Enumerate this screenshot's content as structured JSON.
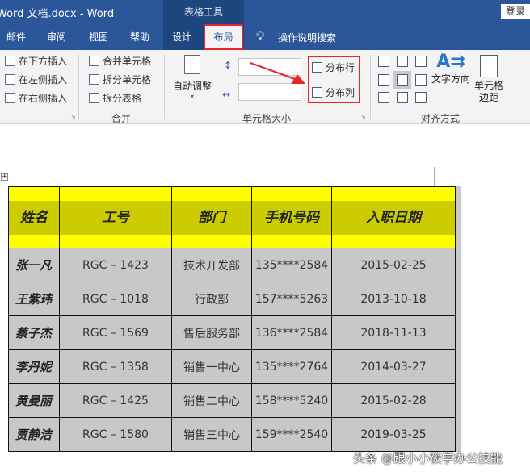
{
  "window": {
    "title": "Word 文档.docx  -  Word",
    "context_tab_group": "表格工具",
    "login_label": "登录"
  },
  "tabs": [
    {
      "label": "邮件"
    },
    {
      "label": "审阅"
    },
    {
      "label": "视图"
    },
    {
      "label": "帮助"
    },
    {
      "label": "设计"
    },
    {
      "label": "布局",
      "active": true
    }
  ],
  "tell_me": "操作说明搜索",
  "ribbon": {
    "rows_cols": {
      "items": [
        "在下方插入",
        "在左侧插入",
        "在右侧插入"
      ]
    },
    "merge": {
      "items": [
        "合并单元格",
        "拆分单元格",
        "拆分表格"
      ],
      "label": "合并"
    },
    "cell_size": {
      "autofit": "自动调整",
      "height_value": "",
      "width_value": "",
      "distribute_rows": "分布行",
      "distribute_cols": "分布列",
      "label": "单元格大小"
    },
    "alignment": {
      "text_direction": "文字方向",
      "cell_margins": "单元格边距",
      "label": "对齐方式"
    }
  },
  "colors": {
    "accent": "#2b579a",
    "highlight": "#e8252b",
    "header_fill": "#ffff00",
    "header_band": "#cccc00",
    "cell_fill": "#c8c8c8"
  },
  "table": {
    "headers": [
      "姓名",
      "工号",
      "部门",
      "手机号码",
      "入职日期"
    ],
    "rows": [
      [
        "张一凡",
        "RGC – 1423",
        "技术开发部",
        "135****2584",
        "2015-02-25"
      ],
      [
        "王紫玮",
        "RGC – 1018",
        "行政部",
        "157****5263",
        "2013-10-18"
      ],
      [
        "蔡子杰",
        "RGC – 1569",
        "售后服务部",
        "136****2584",
        "2018-11-13"
      ],
      [
        "李丹妮",
        "RGC – 1358",
        "销售一中心",
        "135****2764",
        "2014-03-27"
      ],
      [
        "黄曼丽",
        "RGC – 1425",
        "销售二中心",
        "158****5240",
        "2015-02-28"
      ],
      [
        "贾静洁",
        "RGC – 1580",
        "销售三中心",
        "159****2540",
        "2019-03-25"
      ]
    ]
  },
  "watermark": "头条 @跟小小筱学办公技能"
}
